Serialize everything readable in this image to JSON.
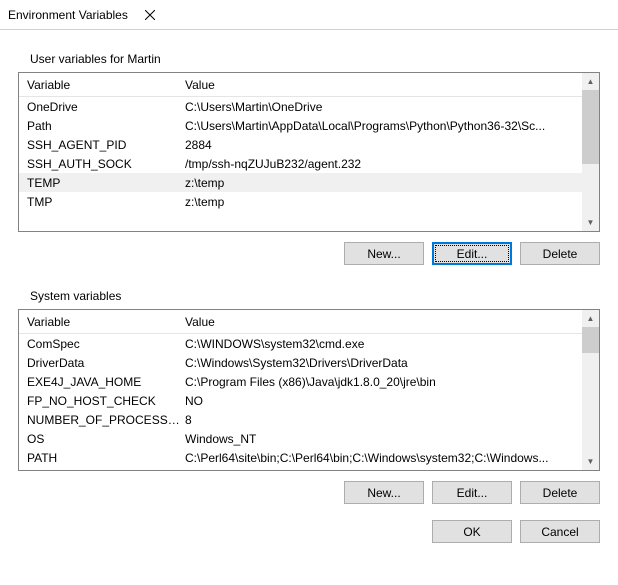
{
  "window": {
    "title": "Environment Variables"
  },
  "user_section": {
    "label": "User variables for Martin",
    "columns": {
      "var": "Variable",
      "val": "Value"
    },
    "rows": [
      {
        "var": "OneDrive",
        "val": "C:\\Users\\Martin\\OneDrive"
      },
      {
        "var": "Path",
        "val": "C:\\Users\\Martin\\AppData\\Local\\Programs\\Python\\Python36-32\\Sc..."
      },
      {
        "var": "SSH_AGENT_PID",
        "val": "2884"
      },
      {
        "var": "SSH_AUTH_SOCK",
        "val": "/tmp/ssh-nqZUJuB232/agent.232"
      },
      {
        "var": "TEMP",
        "val": "z:\\temp",
        "selected": true
      },
      {
        "var": "TMP",
        "val": "z:\\temp"
      }
    ],
    "buttons": {
      "new": "New...",
      "edit": "Edit...",
      "delete": "Delete"
    }
  },
  "system_section": {
    "label": "System variables",
    "columns": {
      "var": "Variable",
      "val": "Value"
    },
    "rows": [
      {
        "var": "ComSpec",
        "val": "C:\\WINDOWS\\system32\\cmd.exe"
      },
      {
        "var": "DriverData",
        "val": "C:\\Windows\\System32\\Drivers\\DriverData"
      },
      {
        "var": "EXE4J_JAVA_HOME",
        "val": "C:\\Program Files (x86)\\Java\\jdk1.8.0_20\\jre\\bin"
      },
      {
        "var": "FP_NO_HOST_CHECK",
        "val": "NO"
      },
      {
        "var": "NUMBER_OF_PROCESSORS",
        "val": "8"
      },
      {
        "var": "OS",
        "val": "Windows_NT"
      },
      {
        "var": "PATH",
        "val": "C:\\Perl64\\site\\bin;C:\\Perl64\\bin;C:\\Windows\\system32;C:\\Windows..."
      }
    ],
    "buttons": {
      "new": "New...",
      "edit": "Edit...",
      "delete": "Delete"
    }
  },
  "dialog_buttons": {
    "ok": "OK",
    "cancel": "Cancel"
  }
}
